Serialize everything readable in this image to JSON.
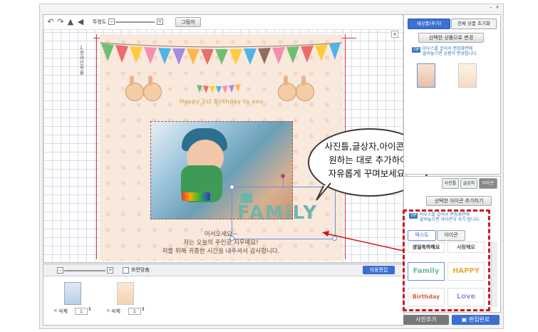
{
  "window": {
    "minimize_glyph": "–",
    "close_glyph": "×"
  },
  "toolbar": {
    "opacity_label": "투명도",
    "image_button": "그림자",
    "slider_minus": "−",
    "slider_plus": "+"
  },
  "guide_label": "1장 라인 부분",
  "card": {
    "birthday_title": "Happy 1st Birthday to you",
    "caption_lines": [
      "어서오세요~",
      "저는 오늘의 주인공 지우예요!",
      "저를 위해 귀중한 시간을 내주셔서 감사합니다."
    ],
    "sticker_text": "FAMiLY"
  },
  "bubble": {
    "lines": [
      "사진틀,글상자,아이콘등",
      "원하는 대로 추가하여",
      "자유롭게 꾸며보세요!"
    ]
  },
  "bottom_strip": {
    "fit_label": "화면맞춤",
    "auto_edit_button": "자동편집",
    "pages": [
      {
        "delete_label": "삭제",
        "qty": "1"
      },
      {
        "delete_label": "삭제",
        "qty": "1"
      }
    ]
  },
  "right_panel_top": {
    "tabs": [
      "새상품(추가)",
      "전체 상품 초기화"
    ],
    "change_button": "선택한 상품으로 변경",
    "tip_badge": "TIP",
    "tip_lines": [
      "마우스를 끌어서 편집화면에",
      "올려놓으면 상품이 변경됩니다."
    ]
  },
  "right_panel_bottom": {
    "tabs": [
      "사진틀",
      "글상자",
      "아이콘"
    ],
    "add_button": "선택한 아이콘 추가하기",
    "tip_badge": "TIP",
    "tip_lines": [
      "마우스를 끌어서 편집화면에",
      "올려놓으면 아이콘이 추가 됩니다."
    ],
    "subtabs": [
      "텍스트",
      "아이콘"
    ],
    "stickers": [
      "생일축하해요",
      "사랑해요",
      "Family",
      "HAPPY",
      "Birthday",
      "Love"
    ]
  },
  "footer": {
    "add_photo": "사진추가",
    "finish": "편집완료"
  },
  "colors": {
    "accent_red": "#e03030",
    "accent_blue": "#3b6fd1",
    "dashed_red": "#d0161b"
  }
}
